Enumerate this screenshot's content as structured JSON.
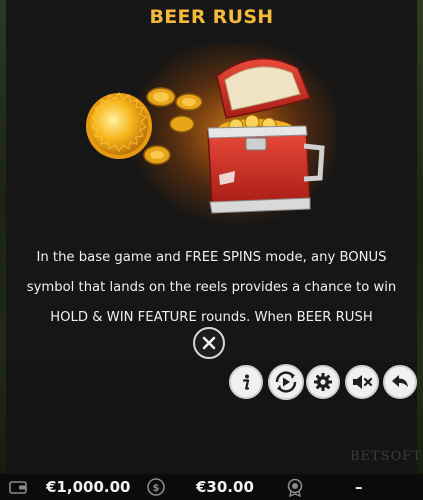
{
  "info": {
    "title": "BEER RUSH",
    "description_lines": [
      "In the base game and FREE SPINS mode, any BONUS",
      "symbol that lands on the reels provides a chance to win",
      "HOLD & WIN FEATURE rounds. When BEER RUSH"
    ]
  },
  "controls": [
    {
      "name": "info-icon"
    },
    {
      "name": "autoplay-icon"
    },
    {
      "name": "settings-gear-icon"
    },
    {
      "name": "sound-muted-icon"
    },
    {
      "name": "back-arrow-icon"
    }
  ],
  "branding": {
    "logo_text": "BETSOFT"
  },
  "bottom_bar": {
    "balance": "€1,000.00",
    "bet": "€30.00",
    "win": "–"
  },
  "colors": {
    "title": "#f2b93c",
    "cooler_red": "#d8342a",
    "coin_gold": "#f6b51a"
  }
}
